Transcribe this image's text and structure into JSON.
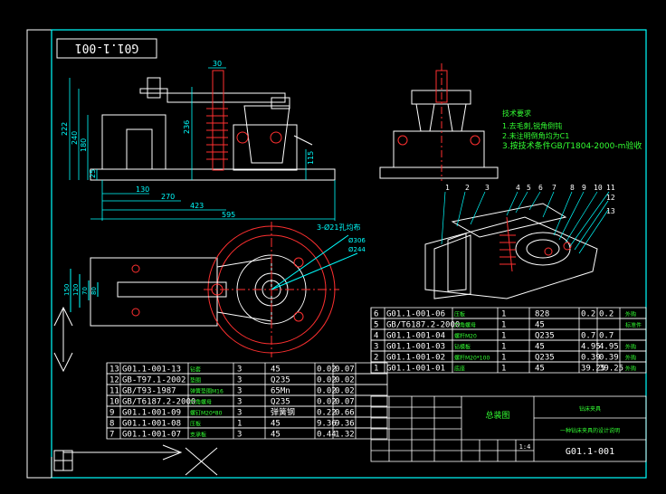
{
  "drawing": {
    "id_box": "G01.1-001",
    "title_block_code": "G01.1-001",
    "scale": "1:4",
    "title_center": "总装图",
    "title_right_top": "钻床夹具",
    "title_right_sub": "一种钻床夹具的设计说明"
  },
  "notes": {
    "heading": "技术要求",
    "items": [
      "1.去毛刺,锐角倒钝",
      "2.未注明倒角均为C1",
      "3.按技术条件GB/T1804-2000-m验收"
    ]
  },
  "dims": {
    "top_width": "30",
    "h1": "222",
    "h2": "240",
    "h3": "180",
    "h4": "25",
    "h5": "236",
    "h6": "115",
    "l1": "130",
    "l2": "270",
    "l3": "423",
    "l4": "595",
    "hole": "3-Ø21孔均布",
    "d1": "Ø306",
    "d2": "Ø244",
    "v1": "150",
    "v2": "120",
    "v3": "70",
    "v4": "80"
  },
  "balloons": [
    "1",
    "2",
    "3",
    "4",
    "5",
    "6",
    "7",
    "8",
    "9",
    "10",
    "11",
    "12",
    "13"
  ],
  "bom_right": [
    {
      "no": "6",
      "code": "G01.1-001-06",
      "name": "压板",
      "qty": "1",
      "mat": "828",
      "w1": "0.2",
      "w2": "0.2",
      "note": "外购"
    },
    {
      "no": "5",
      "code": "GB/T6187.2-2000",
      "name": "六角螺母",
      "qty": "1",
      "mat": "45",
      "w1": "",
      "w2": "",
      "note": "标准件"
    },
    {
      "no": "4",
      "code": "G01.1-001-04",
      "name": "螺杆M20",
      "qty": "1",
      "mat": "Q235",
      "w1": "0.7",
      "w2": "0.7",
      "note": ""
    },
    {
      "no": "3",
      "code": "G01.1-001-03",
      "name": "钻模板",
      "qty": "1",
      "mat": "45",
      "w1": "4.95",
      "w2": "4.95",
      "note": "外购"
    },
    {
      "no": "2",
      "code": "G01.1-001-02",
      "name": "螺杆M20*100",
      "qty": "1",
      "mat": "Q235",
      "w1": "0.39",
      "w2": "0.39",
      "note": "外购"
    },
    {
      "no": "1",
      "code": "G01.1-001-01",
      "name": "底座",
      "qty": "1",
      "mat": "45",
      "w1": "39.25",
      "w2": "39.25",
      "note": "外购"
    }
  ],
  "bom_left": [
    {
      "no": "13",
      "code": "G01.1-001-13",
      "name": "钻套",
      "qty": "3",
      "mat": "45",
      "w1": "0.02",
      "w2": "0.07"
    },
    {
      "no": "12",
      "code": "GB-T97.1-2002",
      "name": "垫圈",
      "qty": "3",
      "mat": "Q235",
      "w1": "0.02",
      "w2": "0.02"
    },
    {
      "no": "11",
      "code": "GB/T93-1987",
      "name": "弹簧垫圈M16",
      "qty": "3",
      "mat": "65Mn",
      "w1": "0.02",
      "w2": "0.02"
    },
    {
      "no": "10",
      "code": "GB/T6187.2-2000",
      "name": "六角螺母",
      "qty": "3",
      "mat": "Q235",
      "w1": "0.02",
      "w2": "0.07"
    },
    {
      "no": "9",
      "code": "G01.1-001-09",
      "name": "螺钉M20*80",
      "qty": "3",
      "mat": "弹簧钢",
      "w1": "0.22",
      "w2": "0.66"
    },
    {
      "no": "8",
      "code": "G01.1-001-08",
      "name": "压板",
      "qty": "1",
      "mat": "45",
      "w1": "9.36",
      "w2": "9.36"
    },
    {
      "no": "7",
      "code": "G01.1-001-07",
      "name": "支承板",
      "qty": "3",
      "mat": "45",
      "w1": "0.44",
      "w2": "1.32"
    }
  ]
}
